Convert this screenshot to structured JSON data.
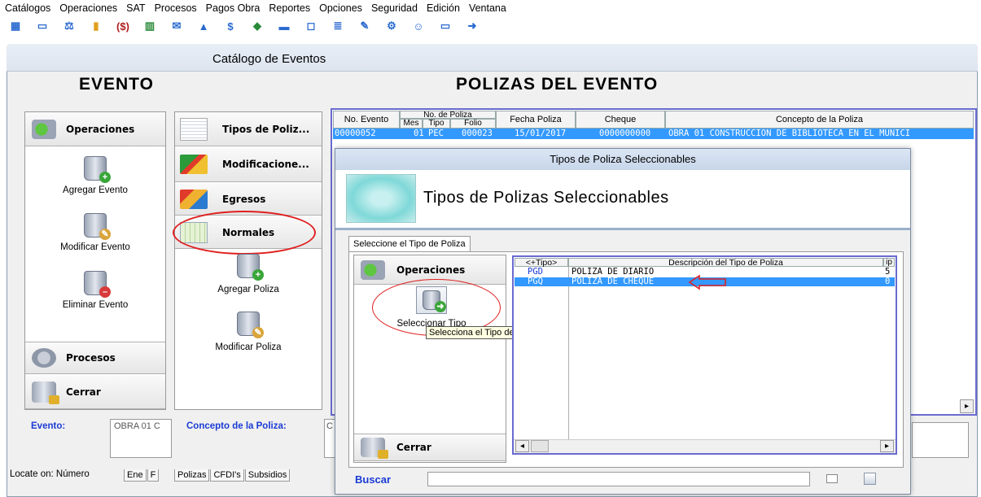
{
  "menu": [
    "Catálogos",
    "Operaciones",
    "SAT",
    "Procesos",
    "Pagos Obra",
    "Reportes",
    "Opciones",
    "Seguridad",
    "Edición",
    "Ventana"
  ],
  "toolbar_icons": [
    "grid-icon",
    "keyboard-icon",
    "scale-icon",
    "chart-icon",
    "money-icon",
    "bank-icon",
    "mail-icon",
    "building-icon",
    "dollar-icon",
    "shovel-icon",
    "tray-icon",
    "window-icon",
    "doc-icon",
    "edit-icon",
    "gear-icon",
    "user-icon",
    "cfdi-icon",
    "export-icon"
  ],
  "toolbar_glyphs": [
    "▦",
    "▭",
    "⚖",
    "▮",
    "($)",
    "▥",
    "✉",
    "▲",
    "$",
    "◆",
    "▬",
    "◻",
    "≣",
    "✎",
    "⚙",
    "☺",
    "▭",
    "➜"
  ],
  "window": {
    "title": "Catálogo de Eventos"
  },
  "left": {
    "heading": "EVENTO",
    "nav": {
      "operaciones": "Operaciones",
      "procesos": "Procesos",
      "cerrar": "Cerrar"
    },
    "actions": {
      "agregar": "Agregar Evento",
      "modificar": "Modificar Evento",
      "eliminar": "Eliminar Evento"
    },
    "evento_label": "Evento:",
    "evento_value": "OBRA 01 C",
    "locate_label": "Locate on: Número",
    "locate_tabs": [
      "Ene",
      "F"
    ]
  },
  "middle": {
    "nav": {
      "tipos": "Tipos de Poliz...",
      "modificaciones": "Modificacione...",
      "egresos": "Egresos",
      "normales": "Normales"
    },
    "actions": {
      "agregar": "Agregar Poliza",
      "modificar": "Modificar Poliza"
    },
    "concepto_label": "Concepto de la Poliza:",
    "concepto_value": "C",
    "tabs": [
      "Polizas",
      "CFDI's",
      "Subsidios"
    ]
  },
  "right": {
    "heading": "POLIZAS DEL EVENTO",
    "columns": {
      "no_evento": "No. Evento",
      "no_poliza": "No. de Poliza",
      "mes": "Mes",
      "tipo": "Tipo",
      "folio": "Folio",
      "fecha": "Fecha Poliza",
      "cheque": "Cheque",
      "concepto": "Concepto de la Poliza"
    },
    "row": {
      "no_evento": "00000052",
      "mes": "01",
      "tipo": "PEC",
      "folio": "000023",
      "fecha": "15/01/2017",
      "cheque": "0000000000",
      "concepto": "OBRA 01 CONSTRUCCION DE BIBLIOTECA EN EL MUNICI"
    },
    "scroll_right": "▸"
  },
  "dialog": {
    "title": "Tipos de Poliza Seleccionables",
    "header": "Tipos de Polizas Seleccionables",
    "tab": "Seleccione el Tipo de Poliza",
    "nav": {
      "operaciones": "Operaciones",
      "cerrar": "Cerrar"
    },
    "action": "Seleccionar Tipo",
    "tooltip": "Selecciona el Tipo de Poliza",
    "columns": {
      "tipo": "<+Tipo>",
      "descripcion": "Descripción del Tipo de Poliza",
      "ip": "ip"
    },
    "rows": [
      {
        "tipo": "PGD",
        "descripcion": "POLIZA DE DIARIO",
        "ip": "5"
      },
      {
        "tipo": "PGQ",
        "descripcion": "POLIZA DE CHEQUE",
        "ip": "0"
      }
    ],
    "search_label": "Buscar",
    "search_value": "",
    "scroll_left": "◂",
    "scroll_right": "▸"
  }
}
